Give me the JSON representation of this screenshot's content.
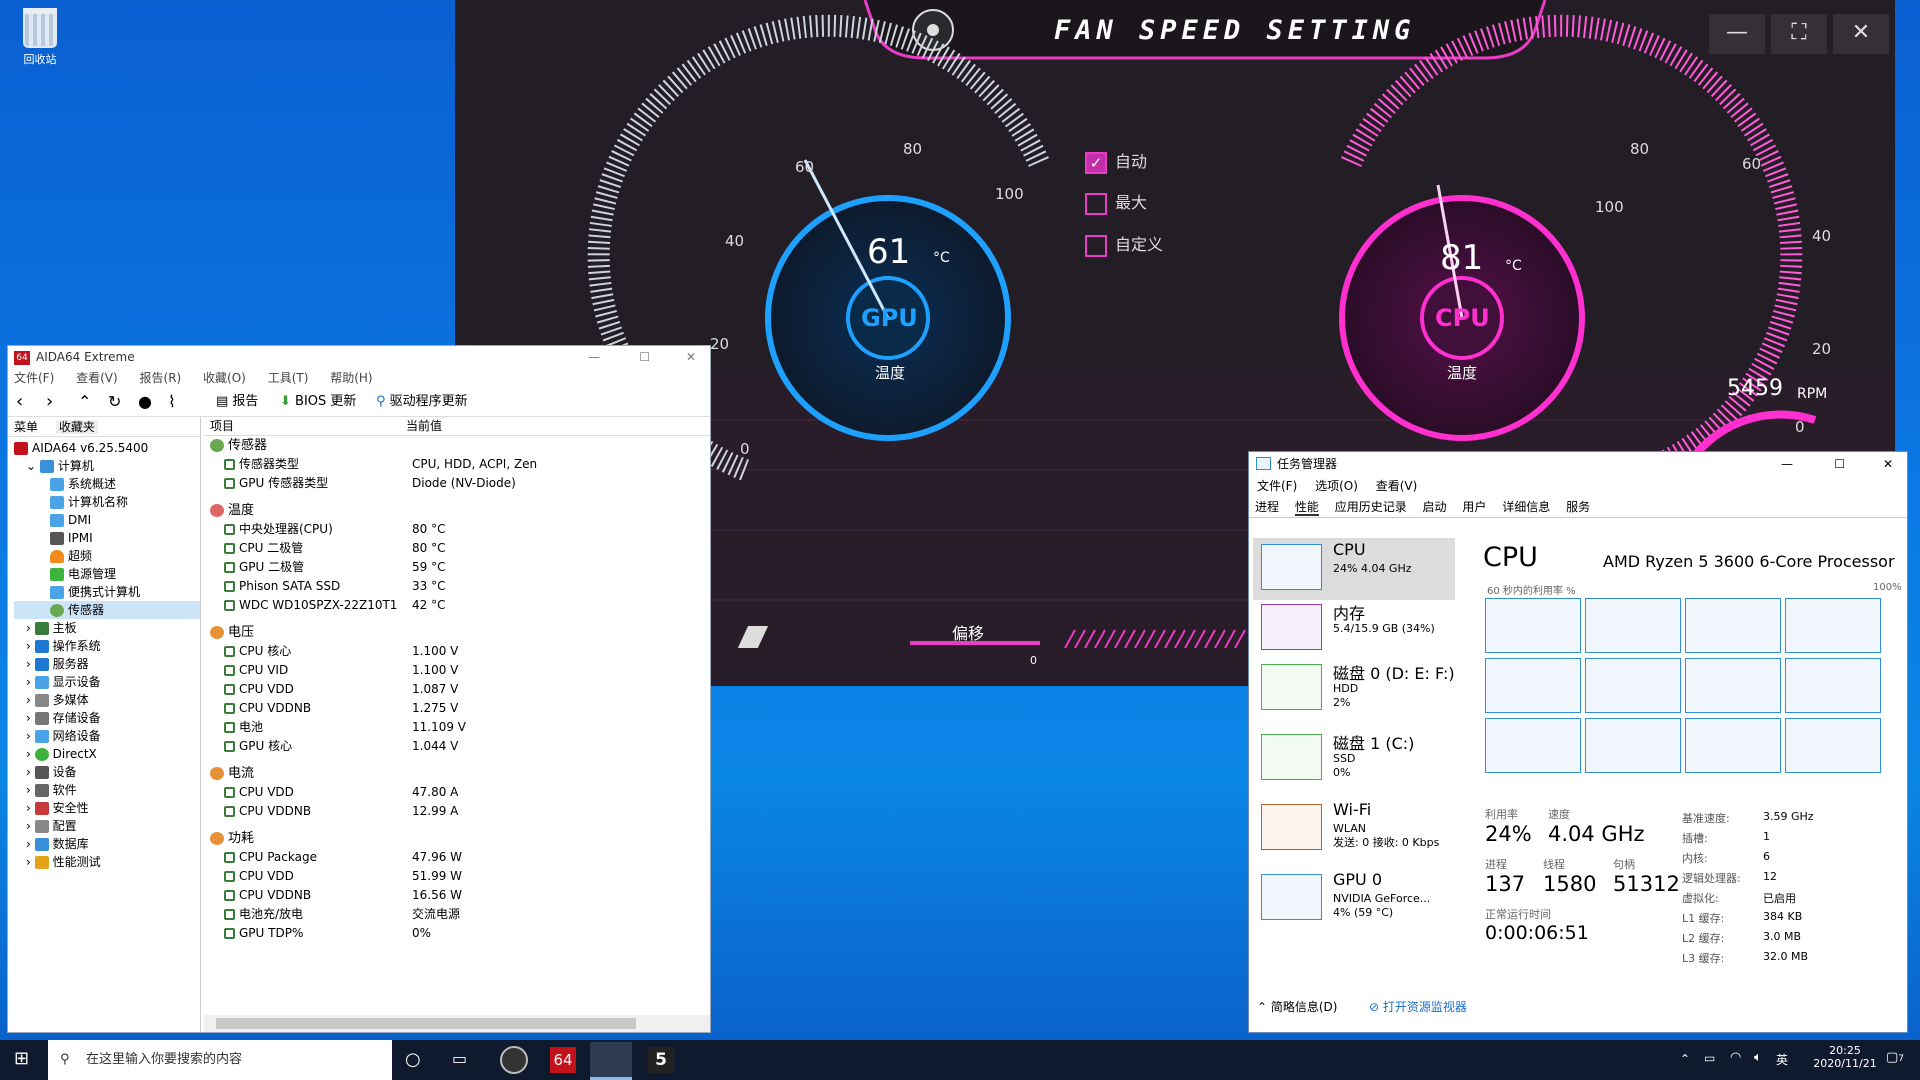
{
  "desktop": {
    "recycle_label": "回收站"
  },
  "fan": {
    "title": "FAN SPEED SETTING",
    "gpu": {
      "temp": "61",
      "unit": "°C",
      "name": "GPU",
      "label": "温度",
      "ticks": [
        "0",
        "20",
        "40",
        "60",
        "80",
        "100"
      ]
    },
    "cpu": {
      "temp": "81",
      "unit": "°C",
      "name": "CPU",
      "label": "温度",
      "ticks": [
        "100",
        "80",
        "60",
        "40",
        "20",
        "0"
      ]
    },
    "options": [
      {
        "label": "自动",
        "checked": true
      },
      {
        "label": "最大",
        "checked": false
      },
      {
        "label": "自定义",
        "checked": false
      }
    ],
    "offset_label": "偏移",
    "offset_value": "0",
    "rpm": "5459",
    "rpm_unit": "RPM",
    "controls": {
      "min": "—",
      "max": "⛶",
      "close": "✕"
    }
  },
  "aida": {
    "title": "AIDA64 Extreme",
    "menu": [
      "文件(F)",
      "查看(V)",
      "报告(R)",
      "收藏(O)",
      "工具(T)",
      "帮助(H)"
    ],
    "toolbar": {
      "report": "报告",
      "bios": "BIOS 更新",
      "driver": "驱动程序更新"
    },
    "tabs": [
      "菜单",
      "收藏夹"
    ],
    "tree_root": "AIDA64 v6.25.5400",
    "tree_computer": "计算机",
    "tree_computer_children": [
      "系统概述",
      "计算机名称",
      "DMI",
      "IPMI",
      "超频",
      "电源管理",
      "便携式计算机",
      "传感器"
    ],
    "tree_top": [
      "主板",
      "操作系统",
      "服务器",
      "显示设备",
      "多媒体",
      "存储设备",
      "网络设备",
      "DirectX",
      "设备",
      "软件",
      "安全性",
      "配置",
      "数据库",
      "性能测试"
    ],
    "col_item": "项目",
    "col_value": "当前值",
    "sections": [
      {
        "title": "传感器",
        "rows": [
          [
            "传感器类型",
            "CPU, HDD, ACPI, Zen"
          ],
          [
            "GPU 传感器类型",
            "Diode  (NV-Diode)"
          ]
        ]
      },
      {
        "title": "温度",
        "rows": [
          [
            "中央处理器(CPU)",
            "80 °C"
          ],
          [
            "CPU 二极管",
            "80 °C"
          ],
          [
            "GPU 二极管",
            "59 °C"
          ],
          [
            "Phison SATA SSD",
            "33 °C"
          ],
          [
            "WDC WD10SPZX-22Z10T1",
            "42 °C"
          ]
        ]
      },
      {
        "title": "电压",
        "rows": [
          [
            "CPU 核心",
            "1.100 V"
          ],
          [
            "CPU VID",
            "1.100 V"
          ],
          [
            "CPU VDD",
            "1.087 V"
          ],
          [
            "CPU VDDNB",
            "1.275 V"
          ],
          [
            "电池",
            "11.109 V"
          ],
          [
            "GPU 核心",
            "1.044 V"
          ]
        ]
      },
      {
        "title": "电流",
        "rows": [
          [
            "CPU VDD",
            "47.80 A"
          ],
          [
            "CPU VDDNB",
            "12.99 A"
          ]
        ]
      },
      {
        "title": "功耗",
        "rows": [
          [
            "CPU Package",
            "47.96 W"
          ],
          [
            "CPU VDD",
            "51.99 W"
          ],
          [
            "CPU VDDNB",
            "16.56 W"
          ],
          [
            "电池充/放电",
            "交流电源"
          ],
          [
            "GPU TDP%",
            "0%"
          ]
        ]
      }
    ]
  },
  "tm": {
    "title": "任务管理器",
    "menu": [
      "文件(F)",
      "选项(O)",
      "查看(V)"
    ],
    "tabs": [
      "进程",
      "性能",
      "应用历史记录",
      "启动",
      "用户",
      "详细信息",
      "服务"
    ],
    "side": [
      {
        "name": "CPU",
        "l1": "24% 4.04 GHz",
        "l2": "",
        "l3": ""
      },
      {
        "name": "内存",
        "l1": "5.4/15.9 GB (34%)",
        "l2": "",
        "l3": ""
      },
      {
        "name": "磁盘 0 (D: E: F:)",
        "l1": "HDD",
        "l2": "2%",
        "l3": ""
      },
      {
        "name": "磁盘 1 (C:)",
        "l1": "SSD",
        "l2": "0%",
        "l3": ""
      },
      {
        "name": "Wi-Fi",
        "l1": "WLAN",
        "l2": "发送: 0 接收: 0 Kbps",
        "l3": ""
      },
      {
        "name": "GPU 0",
        "l1": "NVIDIA GeForce...",
        "l2": "4% (59 °C)",
        "l3": ""
      }
    ],
    "cpu_title": "CPU",
    "cpu_model": "AMD Ryzen 5 3600 6-Core Processor",
    "graph_caption": "60 秒内的利用率 %",
    "graph_max": "100%",
    "stats": {
      "util_l": "利用率",
      "util_v": "24%",
      "speed_l": "速度",
      "speed_v": "4.04 GHz",
      "proc_l": "进程",
      "proc_v": "137",
      "thr_l": "线程",
      "thr_v": "1580",
      "hnd_l": "句柄",
      "hnd_v": "51312",
      "up_l": "正常运行时间",
      "up_v": "0:00:06:51"
    },
    "kv": [
      [
        "基准速度:",
        "3.59 GHz"
      ],
      [
        "插槽:",
        "1"
      ],
      [
        "内核:",
        "6"
      ],
      [
        "逻辑处理器:",
        "12"
      ],
      [
        "虚拟化:",
        "已启用"
      ],
      [
        "L1 缓存:",
        "384 KB"
      ],
      [
        "L2 缓存:",
        "3.0 MB"
      ],
      [
        "L3 缓存:",
        "32.0 MB"
      ]
    ],
    "footer_brief": "简略信息(D)",
    "footer_monitor": "打开资源监视器"
  },
  "taskbar": {
    "search_placeholder": "在这里输入你要搜索的内容",
    "time": "20:25",
    "date": "2020/11/21",
    "ime": "英",
    "notif": "7"
  }
}
